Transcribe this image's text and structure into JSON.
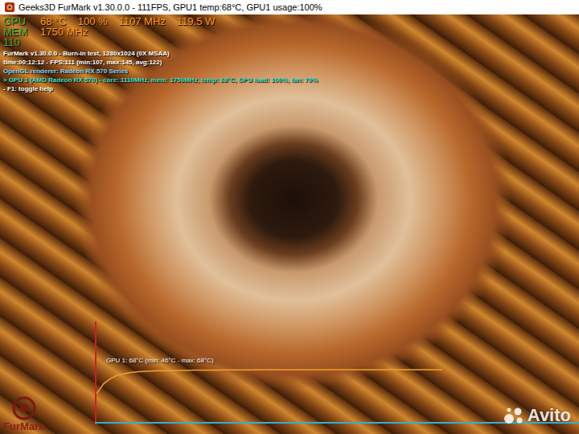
{
  "window": {
    "title": "Geeks3D FurMark v1.30.0.0 - 111FPS, GPU1 temp:68°C, GPU1 usage:100%"
  },
  "osd": [
    {
      "label": "GPU",
      "readings": [
        "68 °C",
        "100 %",
        "1107 MHz",
        "119.5 W"
      ]
    },
    {
      "label": "MEM",
      "readings": [
        "1750 MHz"
      ]
    },
    {
      "label": "110",
      "readings": []
    }
  ],
  "info_lines": [
    {
      "text": "FurMark v1.30.0.0 - Burn-in test, 1280x1024 (0X MSAA)",
      "color": "#ffffff"
    },
    {
      "text": "time:00:12:12 - FPS:111 (min:107, max:145, avg:122)",
      "color": "#ffffff"
    },
    {
      "text": "OpenGL renderer: Radeon RX 570 Series",
      "color": "#7fd7ff"
    },
    {
      "text": "> GPU 1 (AMD Radeon RX 570) - core: 1110MHz, mem: 1750MHz, temp: 68°C, GPU load: 100%, fan: 79%",
      "color": "#33e0c8"
    },
    {
      "text": "- F1: toggle help",
      "color": "#ffffff"
    }
  ],
  "graph": {
    "label": "GPU 1: 68°C (min: 46°C - max: 68°C)",
    "values": [
      46,
      55,
      60,
      63,
      64.5,
      65.5,
      66,
      66.5,
      66.8,
      67,
      67,
      67.2,
      67.3,
      67.4,
      67.5,
      67.5,
      67.6,
      67.6,
      67.7,
      67.7,
      67.8,
      67.8,
      67.8,
      67.9,
      67.9,
      67.9,
      68,
      68,
      68,
      68,
      68,
      68,
      68,
      68,
      68,
      68,
      68,
      68,
      68,
      68,
      68,
      68,
      68,
      68,
      68,
      68,
      68,
      68,
      68,
      68
    ]
  },
  "logo": {
    "text": "FurMark"
  },
  "watermark": {
    "text": "Avito"
  }
}
